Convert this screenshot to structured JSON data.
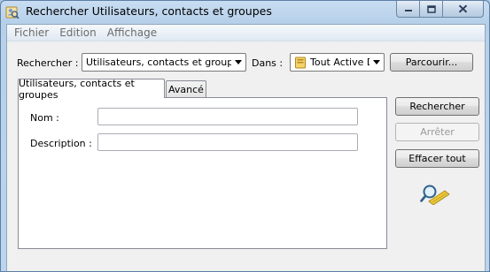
{
  "window": {
    "title": "Rechercher Utilisateurs, contacts et groupes",
    "app_icon": "find-people-icon",
    "buttons": [
      "minimize-icon",
      "maximize-icon",
      "close-icon"
    ]
  },
  "menu": {
    "items": [
      {
        "label": "Fichier"
      },
      {
        "label": "Edition"
      },
      {
        "label": "Affichage"
      }
    ]
  },
  "search": {
    "find_label": "Rechercher :",
    "find_value": "Utilisateurs, contacts et groupes",
    "in_label": "Dans :",
    "in_value": "Tout Active D",
    "in_icon": "directory-icon",
    "browse_label": "Parcourir..."
  },
  "tabs": [
    {
      "label": "Utilisateurs, contacts et groupes",
      "active": true
    },
    {
      "label": "Avancé",
      "active": false
    }
  ],
  "form": {
    "name_label": "Nom :",
    "name_value": "",
    "description_label": "Description :",
    "description_value": ""
  },
  "actions": {
    "search_label": "Rechercher",
    "stop_label": "Arrêter",
    "stop_enabled": false,
    "clear_label": "Effacer tout",
    "graphic_icon": "magnifier-icon"
  },
  "colors": {
    "titlebar": "#b7d0ea",
    "client": "#f0f0f0",
    "disabled_text": "#9a9a9a"
  }
}
